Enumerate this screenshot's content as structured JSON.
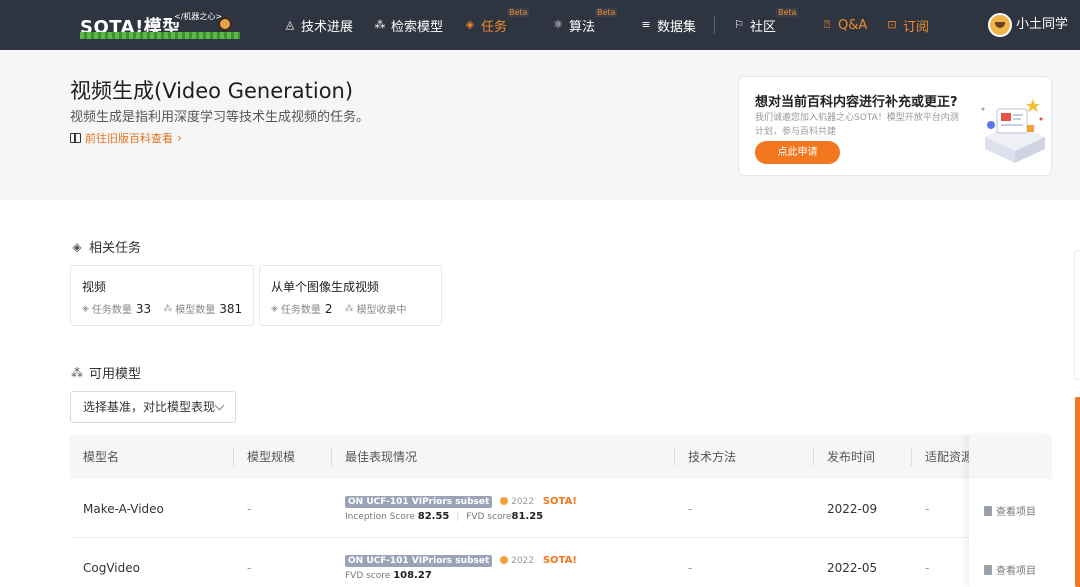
{
  "nav": {
    "logo_text": "SOTA!模型",
    "logo_sub": "</机器之心>",
    "items": [
      {
        "label": "技术进展",
        "icon": "radar-icon"
      },
      {
        "label": "检索模型",
        "icon": "nodes-icon"
      },
      {
        "label": "任务",
        "icon": "layers-icon",
        "beta": "Beta"
      },
      {
        "label": "算法",
        "icon": "atom-icon",
        "beta": "Beta"
      },
      {
        "label": "数据集",
        "icon": "database-icon"
      },
      {
        "label": "社区",
        "icon": "flag-icon",
        "beta": "Beta"
      },
      {
        "label": "Q&A",
        "icon": "qa-icon"
      },
      {
        "label": "订阅",
        "icon": "bookmark-icon"
      }
    ],
    "user_name": "小土同学"
  },
  "hero": {
    "title": "视频生成(Video Generation)",
    "description": "视频生成是指利用深度学习等技术生成视频的任务。",
    "old_link": "前往旧版百科查看",
    "card": {
      "title": "想对当前百科内容进行补充或更正?",
      "description": "我们诚邀您加入机器之心SOTA！模型开放平台内测计划，参与百科共建",
      "button": "点此申请"
    }
  },
  "related": {
    "title": "相关任务",
    "tasks": [
      {
        "name": "视频",
        "task_label": "任务数量",
        "task_count": "33",
        "model_label": "模型数量",
        "model_count": "381"
      },
      {
        "name": "从单个图像生成视频",
        "task_label": "任务数量",
        "task_count": "2",
        "model_label": "模型收录中",
        "model_count": ""
      }
    ]
  },
  "models": {
    "title": "可用模型",
    "dropdown": "选择基准，对比模型表现",
    "headers": [
      "模型名",
      "模型规模",
      "最佳表现情况",
      "技术方法",
      "发布时间",
      "适配资源"
    ],
    "rows": [
      {
        "name": "Make-A-Video",
        "scale": "-",
        "tag": "ON UCF-101 VIPriors subset",
        "year": "2022",
        "sota": "SOTA!",
        "metric1_label": "Inception Score",
        "metric1_value": "82.55",
        "metric2_label": "FVD score",
        "metric2_value": "81.25",
        "method": "-",
        "date": "2022-09",
        "resource": "-",
        "view": "查看项目"
      },
      {
        "name": "CogVideo",
        "scale": "-",
        "tag": "ON UCF-101 VIPriors subset",
        "year": "2022",
        "sota": "SOTA!",
        "metric1_label": "FVD score",
        "metric1_value": "108.27",
        "metric2_label": "",
        "metric2_value": "",
        "method": "-",
        "date": "2022-05",
        "resource": "-",
        "view": "查看项目"
      }
    ]
  },
  "colors": {
    "accent": "#f2771e",
    "nav_bg": "#2f3540",
    "tag_bg": "#9aa3b8"
  }
}
